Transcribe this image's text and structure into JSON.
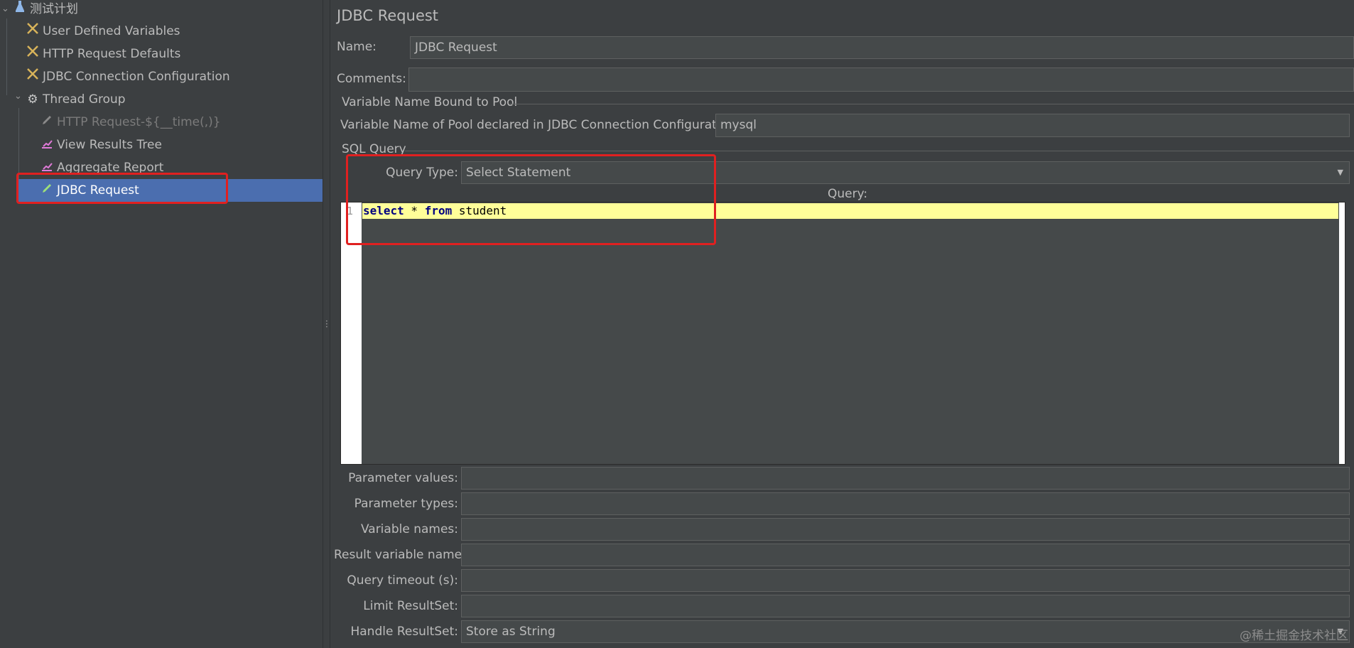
{
  "tree": {
    "root": {
      "label": "测试计划"
    },
    "items": [
      {
        "label": "User Defined Variables"
      },
      {
        "label": "HTTP Request Defaults"
      },
      {
        "label": "JDBC Connection Configuration"
      },
      {
        "label": "Thread Group"
      },
      {
        "label": "HTTP Request-${__time(,)}"
      },
      {
        "label": "View Results Tree"
      },
      {
        "label": "Aggregate Report"
      },
      {
        "label": "JDBC Request"
      }
    ]
  },
  "panel": {
    "title": "JDBC Request",
    "name_label": "Name:",
    "name_value": "JDBC Request",
    "comments_label": "Comments:",
    "comments_value": "",
    "pool_section": "Variable Name Bound to Pool",
    "pool_label": "Variable Name of Pool declared in JDBC Connection Configuration:",
    "pool_value": "mysql",
    "sql_section": "SQL Query",
    "query_type_label": "Query Type:",
    "query_type_value": "Select Statement",
    "query_label": "Query:",
    "line_number": "1",
    "code": {
      "kw1": "select",
      "mid": " * ",
      "kw2": "from",
      "rest": " student"
    },
    "params": [
      {
        "label": "Parameter values:",
        "value": ""
      },
      {
        "label": "Parameter types:",
        "value": ""
      },
      {
        "label": "Variable names:",
        "value": ""
      },
      {
        "label": "Result variable name:",
        "value": ""
      },
      {
        "label": "Query timeout (s):",
        "value": ""
      },
      {
        "label": "Limit ResultSet:",
        "value": ""
      },
      {
        "label": "Handle ResultSet:",
        "value": "Store as String"
      }
    ]
  },
  "watermark": "@稀土掘金技术社区",
  "colors": {
    "accent_selected": "#4b6eaf",
    "highlight_box": "#e02020",
    "editor_line": "#ffff99"
  }
}
